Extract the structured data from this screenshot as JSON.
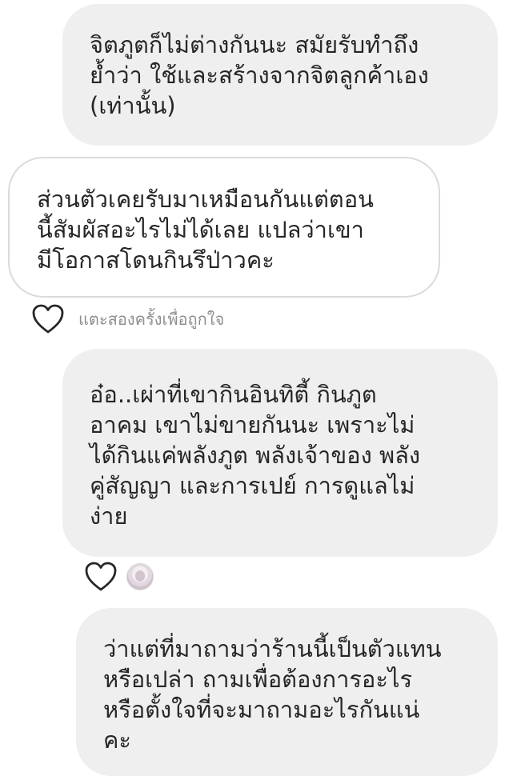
{
  "messages": [
    {
      "id": "msg1",
      "direction": "incoming",
      "text": "จิตภูตก็ไม่ต่างกันนะ สมัยรับทำถึง\nย้ำว่า ใช้และสร้างจากจิตลูกค้าเอง\n(เท่านั้น)"
    },
    {
      "id": "msg2",
      "direction": "outgoing",
      "text": "ส่วนตัวเคยรับมาเหมือนกันแต่ตอน\nนี้สัมผัสอะไรไม่ได้เลย แปลว่าเขา\nมีโอกาสโดนกินรึป่าวคะ"
    },
    {
      "id": "msg3",
      "direction": "incoming",
      "text": "อ๋อ..เผ่าที่เขากินอินทิตี้ กินภูต\nอาคม เขาไม่ขายกันนะ เพราะไม่\nได้กินแค่พลังภูต พลังเจ้าของ พลัง\nคู่สัญญา และการเปย์ การดูแลไม่\nง่าย"
    },
    {
      "id": "msg4",
      "direction": "incoming",
      "text": "ว่าแต่ที่มาถามว่าร้านนี้เป็นตัวแทน\nหรือเปล่า ถามเพื่อต้องการอะไร\nหรือตั้งใจที่จะมาถามอะไรกันแน่\nคะ"
    }
  ],
  "like_hint": "แตะสองครั้งเพื่อถูกใจ",
  "icons": {
    "like": "heart-outline-icon",
    "reactor_avatar": "avatar"
  },
  "colors": {
    "incoming_bubble": "#efefef",
    "outgoing_border": "#dbdbdb",
    "hint_text": "#8e8e8e",
    "text": "#262626"
  }
}
